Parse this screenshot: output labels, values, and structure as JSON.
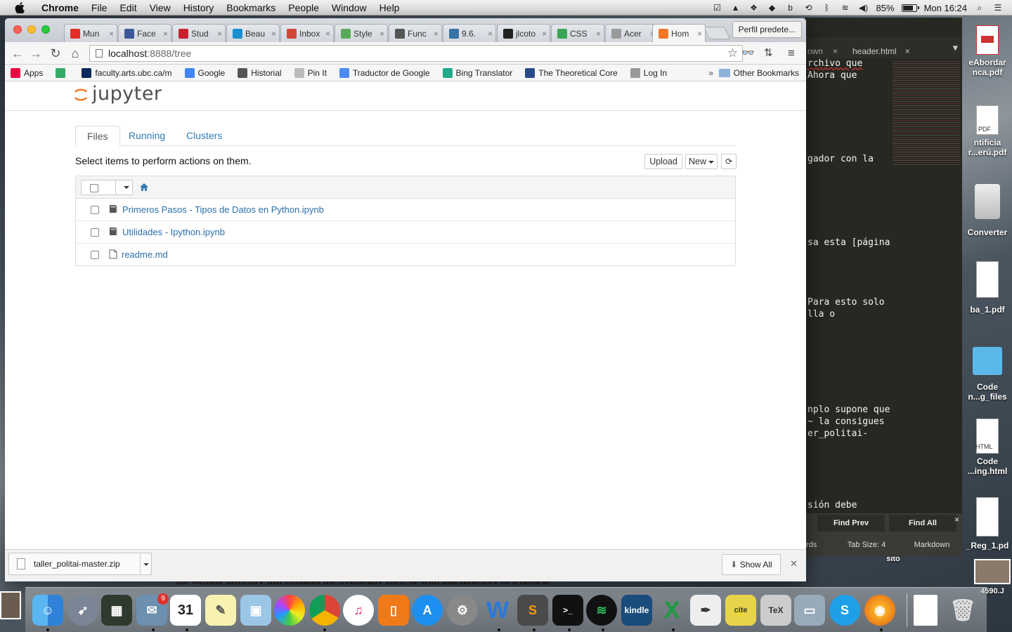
{
  "menubar": {
    "app": "Chrome",
    "items": [
      "File",
      "Edit",
      "View",
      "History",
      "Bookmarks",
      "People",
      "Window",
      "Help"
    ],
    "battery": "85%",
    "clock": "Mon 16:24",
    "battery_level": 0.85
  },
  "browser": {
    "tabs": [
      {
        "label": "Mun",
        "icon": "youtube-icon",
        "color": "#e52d27"
      },
      {
        "label": "Face",
        "icon": "facebook-icon",
        "color": "#3b5998"
      },
      {
        "label": "Stud",
        "icon": "j-icon",
        "color": "#c8202f"
      },
      {
        "label": "Beau",
        "icon": "c-icon",
        "color": "#1a8fd0"
      },
      {
        "label": "Inbox",
        "icon": "gmail-icon",
        "color": "#d14836"
      },
      {
        "label": "Style",
        "icon": "calendar-icon",
        "color": "#5aa95b"
      },
      {
        "label": "Func",
        "icon": "gear-icon",
        "color": "#555555"
      },
      {
        "label": "9.6.",
        "icon": "python-icon",
        "color": "#3572a5"
      },
      {
        "label": "jlcoto",
        "icon": "github-icon",
        "color": "#222222"
      },
      {
        "label": "CSS",
        "icon": "css-icon",
        "color": "#3aa655"
      },
      {
        "label": "Acer",
        "icon": "page-icon",
        "color": "#999999"
      },
      {
        "label": "Hom",
        "icon": "jupyter-icon",
        "color": "#f37726",
        "active": true
      }
    ],
    "profile": "Perfil predete...",
    "url_host": "localhost",
    "url_path": ":8888/tree",
    "bookmarks": [
      {
        "label": "Apps",
        "icon": "apps-icon"
      },
      {
        "label": "",
        "icon": "blog-icon"
      },
      {
        "label": "faculty.arts.ubc.ca/m",
        "icon": "ubc-icon"
      },
      {
        "label": "Google",
        "icon": "google-icon"
      },
      {
        "label": "Historial",
        "icon": "history-icon"
      },
      {
        "label": "Pin It",
        "icon": "page-icon"
      },
      {
        "label": "Traductor de Google",
        "icon": "translate-icon"
      },
      {
        "label": "Bing Translator",
        "icon": "bing-icon"
      },
      {
        "label": "The Theoretical Core",
        "icon": "theory-icon"
      },
      {
        "label": "Log In",
        "icon": "login-icon"
      }
    ],
    "bookmarks_more": "»",
    "other_bookmarks": "Other Bookmarks"
  },
  "jupyter": {
    "logo": "jupyter",
    "tabs": [
      "Files",
      "Running",
      "Clusters"
    ],
    "hint": "Select items to perform actions on them.",
    "upload": "Upload",
    "new": "New",
    "files": [
      {
        "name": "Primeros Pasos - Tipos de Datos en Python.ipynb",
        "type": "notebook"
      },
      {
        "name": "Utilidades - Ipython.ipynb",
        "type": "notebook"
      },
      {
        "name": "readme.md",
        "type": "file"
      }
    ]
  },
  "download": {
    "file": "taller_politai-master.zip",
    "show_all": "Show All"
  },
  "editor": {
    "tabs": [
      "own",
      "header.html"
    ],
    "lines": [
      "rchivo que",
      "Ahora que",
      "gador con la",
      "sa esta [página",
      "Para esto solo",
      "lla o",
      "nplo supone que",
      "~ la consigues",
      "er_politai-",
      "sión debe"
    ],
    "find_prev": "Find Prev",
    "find_all": "Find All",
    "status": [
      "rds",
      "Tab Size: 4",
      "Markdown"
    ]
  },
  "desktop_icons": [
    "eAbordar",
    "nca.pdf",
    "ntificia",
    "r...erú.pdf",
    "Converter",
    "ba_1.pdf",
    "Code",
    "n...g_files",
    "Code",
    "...ing.html",
    "_Reg_1.pd",
    "sito",
    "4590.J"
  ],
  "behind_text": "the website directory that contains the Svelte/apy files, or with that directory of a browse"
}
